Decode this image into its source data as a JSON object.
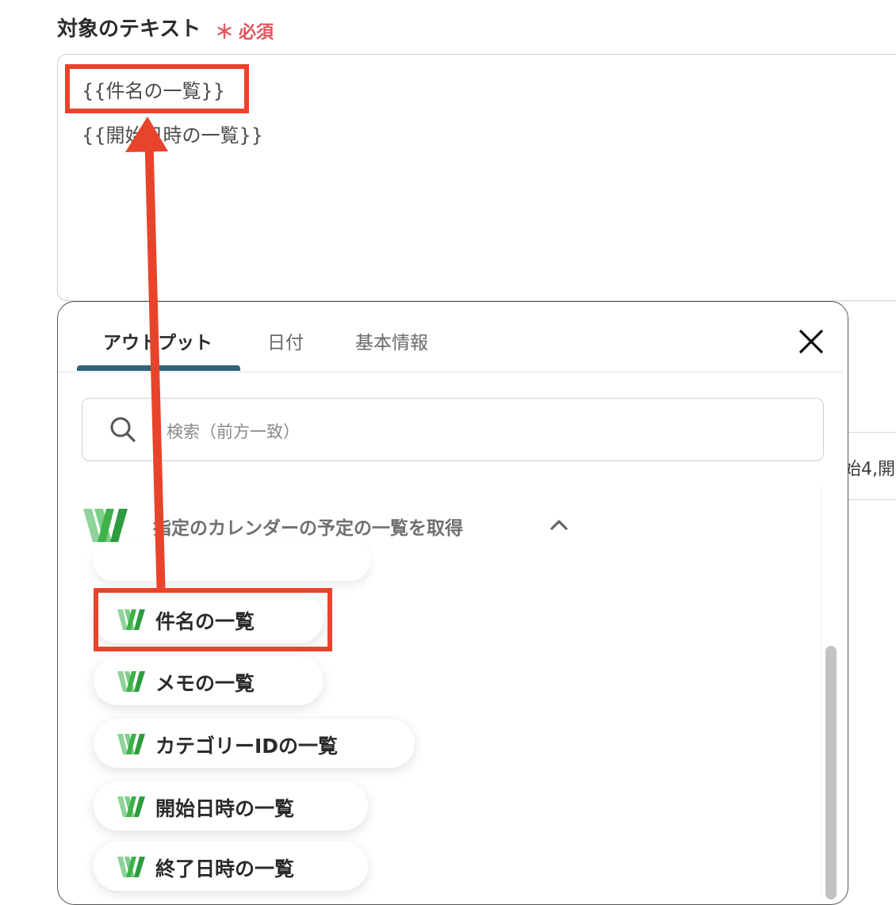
{
  "field": {
    "label": "対象のテキスト",
    "required_star": "＊",
    "required_text": "必須",
    "value_lines": [
      "{{件名の一覧}}",
      "{{開始日時の一覧}}"
    ]
  },
  "background_field": {
    "partial_text": "始4,開"
  },
  "panel": {
    "tabs": [
      {
        "label": "アウトプット",
        "active": true
      },
      {
        "label": "日付",
        "active": false
      },
      {
        "label": "基本情報",
        "active": false
      }
    ],
    "close_icon": "close-icon",
    "search": {
      "placeholder": "検索（前方一致）",
      "icon": "search-icon"
    },
    "section": {
      "title": "指定のカレンダーの予定の一覧を取得",
      "expanded": true,
      "toggle_icon": "chevron-up-icon",
      "items": [
        {
          "label": "件名の一覧",
          "highlighted": true
        },
        {
          "label": "メモの一覧"
        },
        {
          "label": "カテゴリーIDの一覧"
        },
        {
          "label": "開始日時の一覧"
        },
        {
          "label": "終了日時の一覧"
        }
      ]
    }
  },
  "colors": {
    "accent_tab": "#2f6479",
    "required": "#e0555d",
    "annotation": "#e8442b",
    "logo_green": "#3fb14a"
  }
}
